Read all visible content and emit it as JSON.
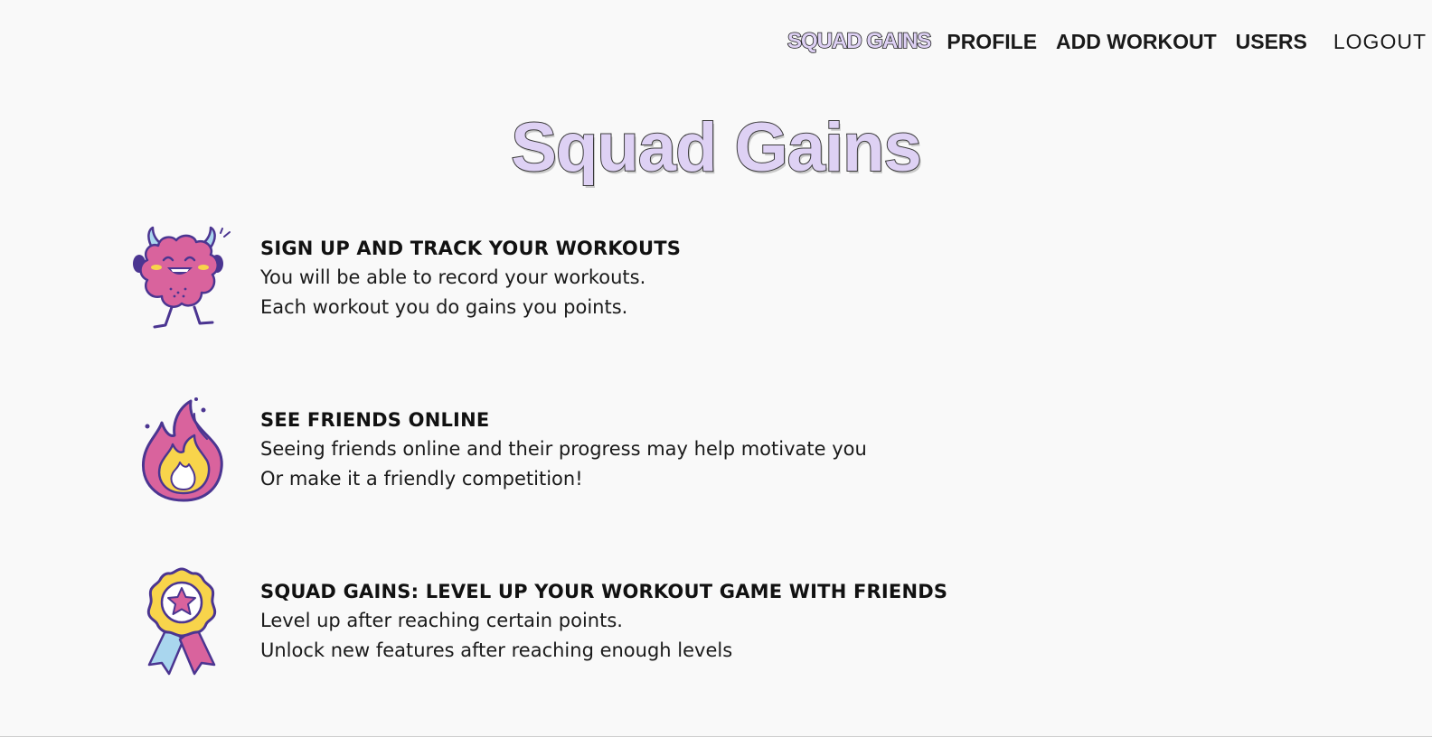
{
  "nav": {
    "brand": "SQUAD GAINS",
    "links": [
      "PROFILE",
      "ADD WORKOUT",
      "USERS"
    ],
    "logout": "LOGOUT"
  },
  "hero": {
    "title": "Squad Gains"
  },
  "features": [
    {
      "icon": "monster-icon",
      "title": "SIGN UP AND TRACK YOUR WORKOUTS",
      "lines": [
        "You will be able to record your workouts.",
        "Each workout you do gains you points."
      ]
    },
    {
      "icon": "fire-icon",
      "title": "SEE FRIENDS ONLINE",
      "lines": [
        "Seeing friends online and their progress may help motivate you",
        "Or make it a friendly competition!"
      ]
    },
    {
      "icon": "award-ribbon-icon",
      "title": "SQUAD GAINS: LEVEL UP YOUR WORKOUT GAME WITH FRIENDS",
      "lines": [
        "Level up after reaching certain points.",
        "Unlock new features after reaching enough levels"
      ]
    }
  ],
  "colors": {
    "background": "#f9f9f9",
    "brand_fill": "#ded1f4",
    "pink": "#d9639d",
    "purple": "#4b3591",
    "yellow": "#f8d44b",
    "light_blue": "#a9d6ee"
  }
}
